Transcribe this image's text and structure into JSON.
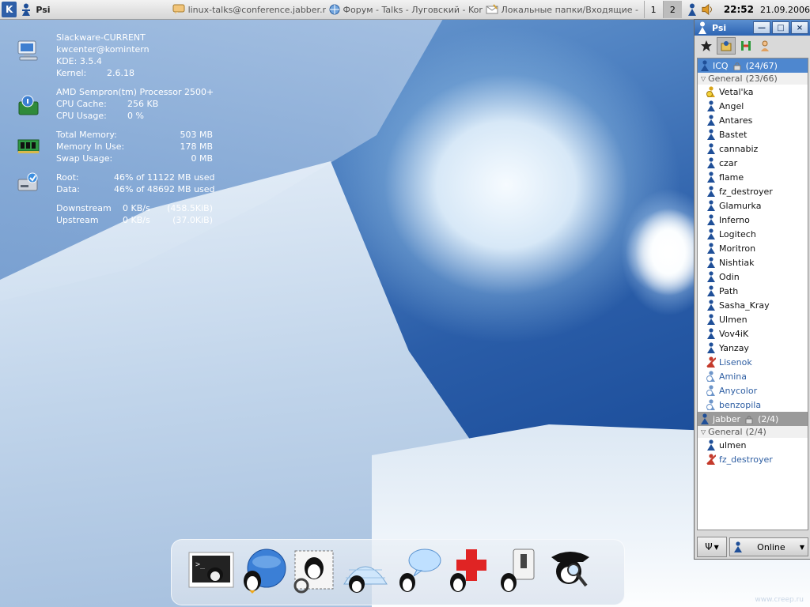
{
  "taskbar": {
    "kmenu_label": "K",
    "tasks": [
      {
        "label": "Psi",
        "icon": "psi-icon"
      },
      {
        "label": "linux-talks@conference.jabber.r",
        "icon": "chat-icon"
      },
      {
        "label": "Форум - Talks - Луговский - Kon",
        "icon": "konqueror-icon"
      },
      {
        "label": "Локальные папки/Входящие - K",
        "icon": "kmail-icon"
      }
    ],
    "desktops": [
      "1",
      "2"
    ],
    "clock": "22:52",
    "date": "21.09.2006"
  },
  "sysinfo": {
    "system": [
      {
        "label": "Slackware-CURRENT",
        "v1": "",
        "v2": ""
      },
      {
        "label": "kwcenter@komintern",
        "v1": "",
        "v2": ""
      },
      {
        "label": "KDE: 3.5.4",
        "v1": "",
        "v2": ""
      },
      {
        "label": "Kernel:",
        "v1": "2.6.18",
        "v2": ""
      }
    ],
    "cpu": [
      {
        "label": "AMD Sempron(tm) Processor 2500+",
        "v1": "",
        "v2": ""
      },
      {
        "label": "CPU Cache:",
        "v1": "256 KB",
        "v2": ""
      },
      {
        "label": "CPU Usage:",
        "v1": "0 %",
        "v2": ""
      }
    ],
    "memory": [
      {
        "label": "Total Memory:",
        "v1": "",
        "v2": "503 MB"
      },
      {
        "label": "Memory In Use:",
        "v1": "",
        "v2": "178 MB"
      },
      {
        "label": "Swap Usage:",
        "v1": "",
        "v2": "0 MB"
      }
    ],
    "disk": [
      {
        "label": "Root:",
        "v1": "46% of 11122 MB used",
        "v2": ""
      },
      {
        "label": "Data:",
        "v1": "46% of 48692 MB used",
        "v2": ""
      }
    ],
    "network": [
      {
        "label": "Downstream",
        "v1": "0 KB/s",
        "v2": "(458.5KiB)"
      },
      {
        "label": "Upstream",
        "v1": "0 KB/s",
        "v2": "(37.0KiB)"
      }
    ]
  },
  "dock": {
    "items": [
      {
        "name": "terminal-icon"
      },
      {
        "name": "browser-globe-icon"
      },
      {
        "name": "mail-stamp-icon"
      },
      {
        "name": "igloo-home-icon"
      },
      {
        "name": "chat-bubble-icon"
      },
      {
        "name": "red-cross-help-icon"
      },
      {
        "name": "power-switch-icon"
      },
      {
        "name": "pirate-search-icon"
      }
    ]
  },
  "psi": {
    "title": "Psi",
    "window_buttons": [
      "—",
      "□",
      "×"
    ],
    "accounts": [
      {
        "name": "ICQ",
        "count": "(24/67)",
        "selected": true,
        "group": "General",
        "group_count": "(23/66)",
        "contacts": [
          {
            "name": "Vetal'ka",
            "status": "away"
          },
          {
            "name": "Angel",
            "status": "online"
          },
          {
            "name": "Antares",
            "status": "online"
          },
          {
            "name": "Bastet",
            "status": "online"
          },
          {
            "name": "cannabiz",
            "status": "online"
          },
          {
            "name": "czar",
            "status": "online"
          },
          {
            "name": "flame",
            "status": "online"
          },
          {
            "name": "fz_destroyer",
            "status": "online"
          },
          {
            "name": "Glamurka",
            "status": "online"
          },
          {
            "name": "Inferno",
            "status": "online"
          },
          {
            "name": "Logitech",
            "status": "online"
          },
          {
            "name": "Moritron",
            "status": "online"
          },
          {
            "name": "Nishtiak",
            "status": "online"
          },
          {
            "name": "Odin",
            "status": "online"
          },
          {
            "name": "Path",
            "status": "online"
          },
          {
            "name": "Sasha_Kray",
            "status": "online"
          },
          {
            "name": "Ulmen",
            "status": "online"
          },
          {
            "name": "Vov4iK",
            "status": "online"
          },
          {
            "name": "Yanzay",
            "status": "online"
          },
          {
            "name": "Lisenok",
            "status": "offline-red"
          },
          {
            "name": "Amina",
            "status": "offline"
          },
          {
            "name": "Anycolor",
            "status": "offline"
          },
          {
            "name": "benzopila",
            "status": "offline"
          }
        ]
      },
      {
        "name": "jabber",
        "count": "(2/4)",
        "selected": false,
        "group": "General",
        "group_count": "(2/4)",
        "contacts": [
          {
            "name": "ulmen",
            "status": "online"
          },
          {
            "name": "fz_destroyer",
            "status": "offline-red"
          }
        ]
      }
    ],
    "status_label": "Online"
  },
  "watermark": "www.creep.ru",
  "colors": {
    "online": "#1f4f98",
    "away": "#d9a51a",
    "offline": "#6d95c9",
    "offline_red": "#c43a2b",
    "selected": "#4e87cf"
  }
}
